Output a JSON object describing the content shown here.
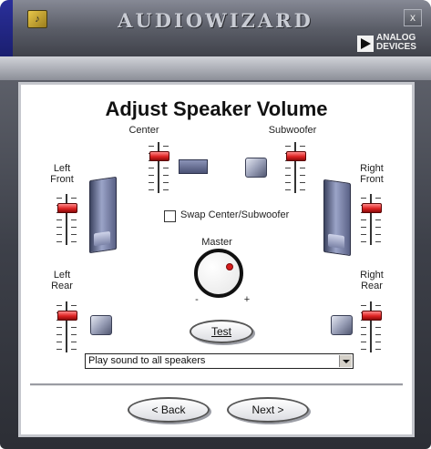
{
  "window": {
    "app_title": "AUDIOWIZARD",
    "close_label": "x",
    "brand": [
      "ANALOG",
      "DEVICES"
    ]
  },
  "page": {
    "heading": "Adjust Speaker Volume"
  },
  "speakers": {
    "center": "Center",
    "subwoofer": "Subwoofer",
    "left_front": [
      "Left",
      "Front"
    ],
    "right_front": [
      "Right",
      "Front"
    ],
    "left_rear": [
      "Left",
      "Rear"
    ],
    "right_rear": [
      "Right",
      "Rear"
    ],
    "master": "Master"
  },
  "swap_checkbox": {
    "label": "Swap Center/Subwoofer",
    "checked": false
  },
  "knob": {
    "minus": "-",
    "plus": "+"
  },
  "test_button": "Test",
  "dropdown": {
    "selected": "Play sound to all speakers"
  },
  "nav": {
    "back": "< Back",
    "next": "Next >"
  },
  "colors": {
    "slider_thumb": "#d22222",
    "speaker": "#5a6186",
    "knob_indicator": "#d61b1b"
  }
}
